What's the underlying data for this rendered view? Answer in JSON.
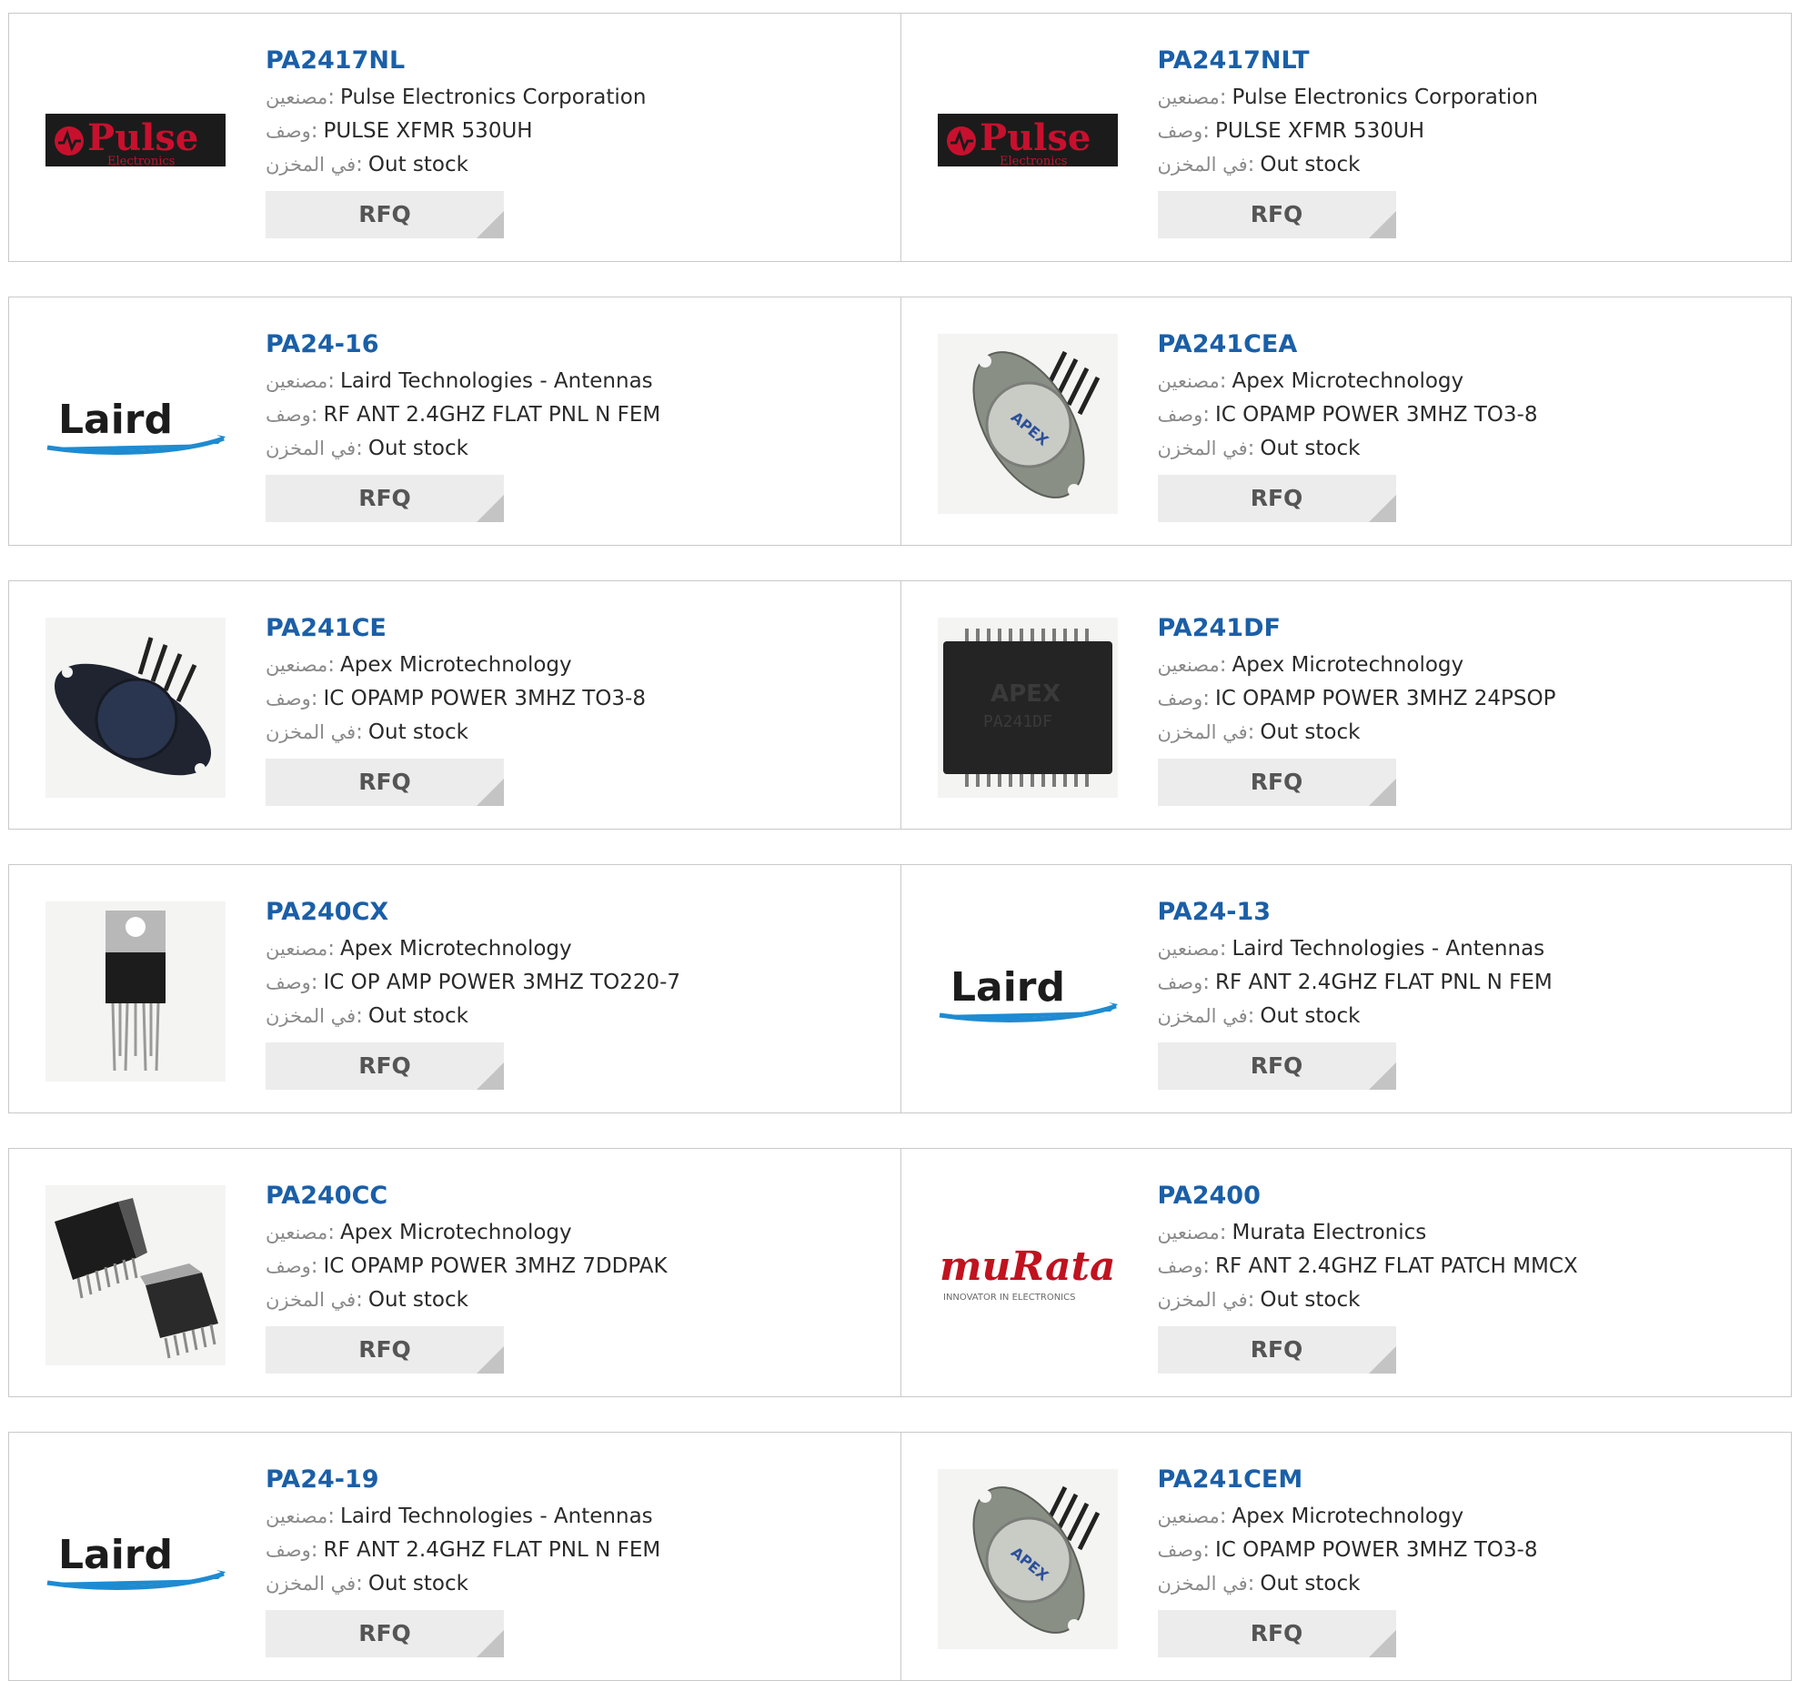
{
  "labels": {
    "manufacturer": "مصنعين",
    "description": "وصف",
    "stock": "في المخزن",
    "colon": ":",
    "rfq": "RFQ"
  },
  "rows": [
    [
      {
        "part": "PA2417NL",
        "manufacturer": "Pulse Electronics Corporation",
        "description": "PULSE XFMR 530UH",
        "stock": "Out stock",
        "image": "pulse-logo"
      },
      {
        "part": "PA2417NLT",
        "manufacturer": "Pulse Electronics Corporation",
        "description": "PULSE XFMR 530UH",
        "stock": "Out stock",
        "image": "pulse-logo"
      }
    ],
    [
      {
        "part": "PA24-16",
        "manufacturer": "Laird Technologies - Antennas",
        "description": "RF ANT 2.4GHZ FLAT PNL N FEM",
        "stock": "Out stock",
        "image": "laird-logo"
      },
      {
        "part": "PA241CEA",
        "manufacturer": "Apex Microtechnology",
        "description": "IC OPAMP POWER 3MHZ TO3-8",
        "stock": "Out stock",
        "image": "to3-package"
      }
    ],
    [
      {
        "part": "PA241CE",
        "manufacturer": "Apex Microtechnology",
        "description": "IC OPAMP POWER 3MHZ TO3-8",
        "stock": "Out stock",
        "image": "to3-package-dark"
      },
      {
        "part": "PA241DF",
        "manufacturer": "Apex Microtechnology",
        "description": "IC OPAMP POWER 3MHZ 24PSOP",
        "stock": "Out stock",
        "image": "psop-chip"
      }
    ],
    [
      {
        "part": "PA240CX",
        "manufacturer": "Apex Microtechnology",
        "description": "IC OP AMP POWER 3MHZ TO220-7",
        "stock": "Out stock",
        "image": "to220-package"
      },
      {
        "part": "PA24-13",
        "manufacturer": "Laird Technologies - Antennas",
        "description": "RF ANT 2.4GHZ FLAT PNL N FEM",
        "stock": "Out stock",
        "image": "laird-logo"
      }
    ],
    [
      {
        "part": "PA240CC",
        "manufacturer": "Apex Microtechnology",
        "description": "IC OPAMP POWER 3MHZ 7DDPAK",
        "stock": "Out stock",
        "image": "ddpak-package"
      },
      {
        "part": "PA2400",
        "manufacturer": "Murata Electronics",
        "description": "RF ANT 2.4GHZ FLAT PATCH MMCX",
        "stock": "Out stock",
        "image": "murata-logo"
      }
    ],
    [
      {
        "part": "PA24-19",
        "manufacturer": "Laird Technologies - Antennas",
        "description": "RF ANT 2.4GHZ FLAT PNL N FEM",
        "stock": "Out stock",
        "image": "laird-logo"
      },
      {
        "part": "PA241CEM",
        "manufacturer": "Apex Microtechnology",
        "description": "IC OPAMP POWER 3MHZ TO3-8",
        "stock": "Out stock",
        "image": "to3-package"
      }
    ]
  ],
  "logos": {
    "pulse": {
      "word": "Pulse",
      "sub": "Electronics"
    },
    "laird": {
      "word": "Laird"
    },
    "murata": {
      "word": "muRata",
      "tagline": "INNOVATOR IN ELECTRONICS"
    },
    "apex_marking": {
      "brand": "APEX",
      "part": "PA241DF"
    }
  },
  "colors": {
    "part_link": "#1a5fa8",
    "border": "#c9c9c9",
    "rfq_bg": "#ececec",
    "pulse_red": "#c8102e",
    "laird_blue": "#1e8bd1",
    "murata_red": "#c1121f"
  }
}
